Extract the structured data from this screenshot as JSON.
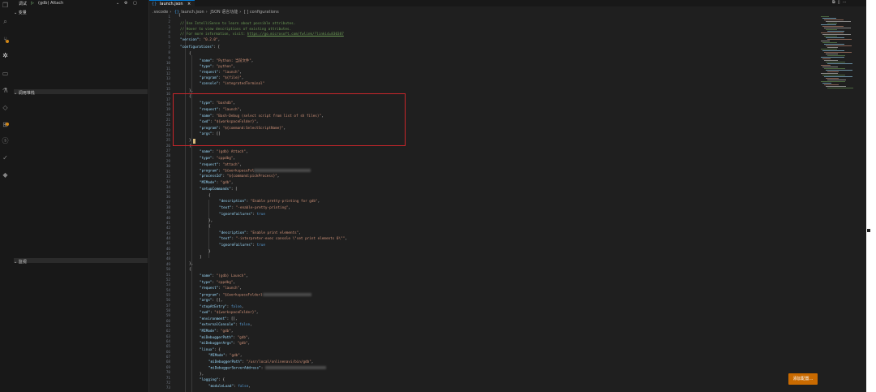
{
  "sidebar": {
    "debug_label": "调试",
    "config_name": "(gdb) Attach",
    "sections": [
      "变量",
      "调用堆栈",
      "监视"
    ]
  },
  "tab": {
    "label": "launch.json"
  },
  "breadcrumb": [
    ".vscode",
    "launch.json",
    "JSON 语言功能",
    "[ ] configurations"
  ],
  "line_numbers": [
    "1",
    "2",
    "3",
    "4",
    "5",
    "6",
    "7",
    "8",
    "9",
    "10",
    "11",
    "12",
    "13",
    "14",
    "15",
    "16",
    "17",
    "18",
    "19",
    "20",
    "21",
    "22",
    "23",
    "24",
    "25",
    "26",
    "27",
    "28",
    "29",
    "30",
    "31",
    "32",
    "33",
    "34",
    "35",
    "36",
    "37",
    "38",
    "39",
    "40",
    "41",
    "42",
    "43",
    "44",
    "45",
    "46",
    "47",
    "48",
    "49",
    "50",
    "51",
    "52",
    "53",
    "54",
    "55",
    "56",
    "57",
    "58",
    "59",
    "60",
    "61",
    "62",
    "63",
    "64",
    "65",
    "66",
    "67",
    "68",
    "69",
    "70",
    "71",
    "72",
    "73"
  ],
  "code": {
    "l2": "// Use IntelliSense to learn about possible attributes.",
    "l3": "// Hover to view descriptions of existing attributes.",
    "l4a": "// For more information, visit: ",
    "l4b": "https://go.microsoft.com/fwlink/?linkid=830387",
    "version_key": "\"version\"",
    "version_val": "\"0.2.0\"",
    "configs_key": "\"configurations\"",
    "name_key": "\"name\"",
    "type_key": "\"type\"",
    "request_key": "\"request\"",
    "program_key": "\"program\"",
    "console_key": "\"console\"",
    "cwd_key": "\"cwd\"",
    "args_key": "\"args\"",
    "processid_key": "\"processId\"",
    "mimode_key": "\"MIMode\"",
    "setup_key": "\"setupCommands\"",
    "desc_key": "\"description\"",
    "text_key": "\"text\"",
    "ignore_key": "\"ignoreFailures\"",
    "stopentry_key": "\"stopAtEntry\"",
    "env_key": "\"environment\"",
    "extconsole_key": "\"externalConsole\"",
    "midbg_path_key": "\"miDebuggerPath\"",
    "midbg_args_key": "\"miDebuggerArgs\"",
    "linux_key": "\"linux\"",
    "midbg_server_key": "\"miDebuggerServerAddress\"",
    "logging_key": "\"logging\"",
    "moduleload_key": "\"moduleLoad\"",
    "py_name": "\"Python: 当前文件\"",
    "py_type": "\"python\"",
    "launch": "\"launch\"",
    "py_program": "\"${file}\"",
    "py_console": "\"integratedTerminal\"",
    "bash_type": "\"bashdb\"",
    "bash_name": "\"Bash-Debug (select script from list of sh files)\"",
    "ws_folder": "\"${workspaceFolder}\"",
    "bash_program": "\"${command:SelectScriptName}\"",
    "empty_arr": "[]",
    "attach_name": "\"(gdb) Attach\"",
    "cppdbg": "\"cppdbg\"",
    "attach": "\"attach\"",
    "prog_partial": "\"${workspaceFol",
    "pick_process": "\"${command:pickProcess}\"",
    "gdb": "\"gdb\"",
    "desc1": "\"Enable pretty-printing for gdb\"",
    "text1": "\"-enable-pretty-printing\"",
    "true_val": "true",
    "desc2": "\"Enable print elements\"",
    "text2": "\"-interpreter-exec console \\\"set print elements 0\\\"\"",
    "launch_name": "\"(gdb) Launch\"",
    "prog_partial2": "\"${workspaceFolder}",
    "false_val": "false",
    "linux_mimode": "\"MIMode\"",
    "linux_path": "\"/usr/local/onlinenavi/bin/gdb\""
  },
  "add_config_button": "添加配置..."
}
